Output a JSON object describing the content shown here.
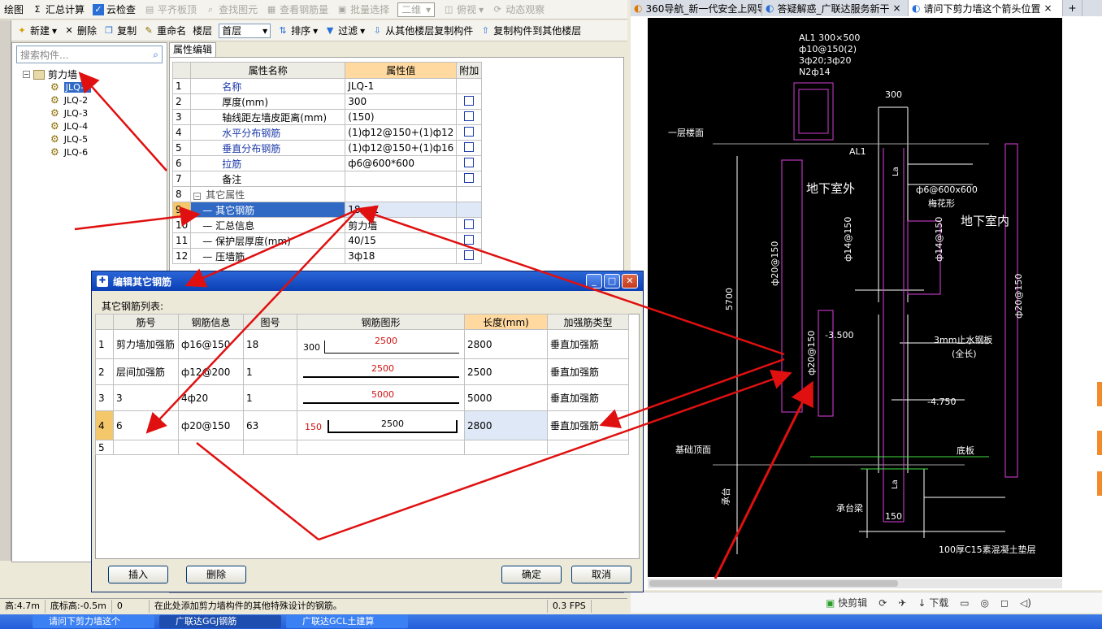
{
  "toolbar1": {
    "draw": "绘图",
    "sum": "汇总计算",
    "cloud": "云检查",
    "align": "平齐板顶",
    "find": "查找图元",
    "view_rebar": "查看钢筋量",
    "batch": "批量选择",
    "view2d": "二维",
    "topview": "俯视",
    "dynamic": "动态观察"
  },
  "toolbar2": {
    "new": "新建",
    "delete": "删除",
    "copy": "复制",
    "rename": "重命名",
    "floor_label": "楼层",
    "floor_value": "首层",
    "sort": "排序",
    "filter": "过滤",
    "copy_from": "从其他楼层复制构件",
    "copy_to": "复制构件到其他楼层"
  },
  "search": {
    "placeholder": "搜索构件..."
  },
  "tree": {
    "root": "剪力墙",
    "items": [
      "JLQ-1",
      "JLQ-2",
      "JLQ-3",
      "JLQ-4",
      "JLQ-5",
      "JLQ-6"
    ]
  },
  "prop_tab": "属性编辑",
  "prop_headers": {
    "name": "属性名称",
    "value": "属性值",
    "extra": "附加"
  },
  "props": [
    {
      "no": "1",
      "name": "名称",
      "value": "JLQ-1"
    },
    {
      "no": "2",
      "name": "厚度(mm)",
      "value": "300"
    },
    {
      "no": "3",
      "name": "轴线距左墙皮距离(mm)",
      "value": "(150)"
    },
    {
      "no": "4",
      "name": "水平分布钢筋",
      "value": "(1)ф12@150+(1)ф12"
    },
    {
      "no": "5",
      "name": "垂直分布钢筋",
      "value": "(1)ф12@150+(1)ф16"
    },
    {
      "no": "6",
      "name": "拉筋",
      "value": "ф6@600*600"
    },
    {
      "no": "7",
      "name": "备注",
      "value": ""
    },
    {
      "no": "8",
      "name": "其它属性",
      "value": ""
    },
    {
      "no": "9",
      "name": "其它钢筋",
      "value": "18,...1"
    },
    {
      "no": "10",
      "name": "汇总信息",
      "value": "剪力墙"
    },
    {
      "no": "11",
      "name": "保护层厚度(mm)",
      "value": "40/15"
    },
    {
      "no": "12",
      "name": "压墙筋",
      "value": "3ф18"
    }
  ],
  "dialog": {
    "title": "编辑其它钢筋",
    "list_label": "其它钢筋列表:",
    "headers": {
      "no": "筋号",
      "info": "钢筋信息",
      "fig": "图号",
      "shape": "钢筋图形",
      "length": "长度(mm)",
      "type": "加强筋类型"
    },
    "rows": [
      {
        "idx": "1",
        "no": "剪力墙加强筋",
        "info": "ф16@150",
        "fig": "18",
        "shape_left": "300",
        "shape_mid": "2500",
        "length": "2800",
        "type": "垂直加强筋"
      },
      {
        "idx": "2",
        "no": "层间加强筋",
        "info": "ф12@200",
        "fig": "1",
        "shape_left": "",
        "shape_mid": "2500",
        "length": "2500",
        "type": "垂直加强筋"
      },
      {
        "idx": "3",
        "no": "3",
        "info": "4ф20",
        "fig": "1",
        "shape_left": "",
        "shape_mid": "5000",
        "length": "5000",
        "type": "垂直加强筋"
      },
      {
        "idx": "4",
        "no": "6",
        "info": "ф20@150",
        "fig": "63",
        "shape_left": "150",
        "shape_mid": "2500",
        "length": "2800",
        "type": "垂直加强筋"
      },
      {
        "idx": "5",
        "no": "",
        "info": "",
        "fig": "",
        "shape_left": "",
        "shape_mid": "",
        "length": "",
        "type": ""
      }
    ],
    "btn_insert": "插入",
    "btn_delete": "删除",
    "btn_ok": "确定",
    "btn_cancel": "取消"
  },
  "status": {
    "height": "高:4.7m",
    "bottom": "底标高:-0.5m",
    "zero": "0",
    "hint": "在此处添加剪力墙构件的其他特殊设计的钢筋。",
    "fps": "0.3 FPS"
  },
  "browser": {
    "tab1": "360导航_新一代安全上网导",
    "tab2": "答疑解惑_广联达服务新干",
    "tab3": "请问下剪力墙这个箭头位置",
    "plus": "+",
    "quick_cut": "快剪辑",
    "download": "下载"
  },
  "cad": {
    "al1_head": "AL1 300×500",
    "al1_l2": "ф10@150(2)",
    "al1_l3": "3ф20;3ф20",
    "al1_l4": "N2ф14",
    "dim300": "300",
    "first_floor": "一层楼面",
    "al1": "AL1",
    "outdoor": "地下室外",
    "tie": "ф6@600x600",
    "tie2": "梅花形",
    "indoor": "地下室内",
    "v14a": "ф14@150",
    "v14b": "ф14@150",
    "v20a": "ф20@150",
    "v20b": "ф20@150",
    "v20c": "ф20@150",
    "h5700": "5700",
    "lev1": "-3.500",
    "lev2": "-4.750",
    "waterstop": "3mm止水钢板",
    "waterstop2": "(全长)",
    "found_top": "基础顶面",
    "slab": "底板",
    "cap": "承台梁",
    "cap2": "承台",
    "dim150": "150",
    "bedding": "100厚C15素混凝土垫层",
    "la1": "La",
    "la2": "La"
  },
  "taskbar": [
    "请问下剪力墙这个",
    "广联达GGJ钢筋",
    "广联达GCL土建算"
  ]
}
